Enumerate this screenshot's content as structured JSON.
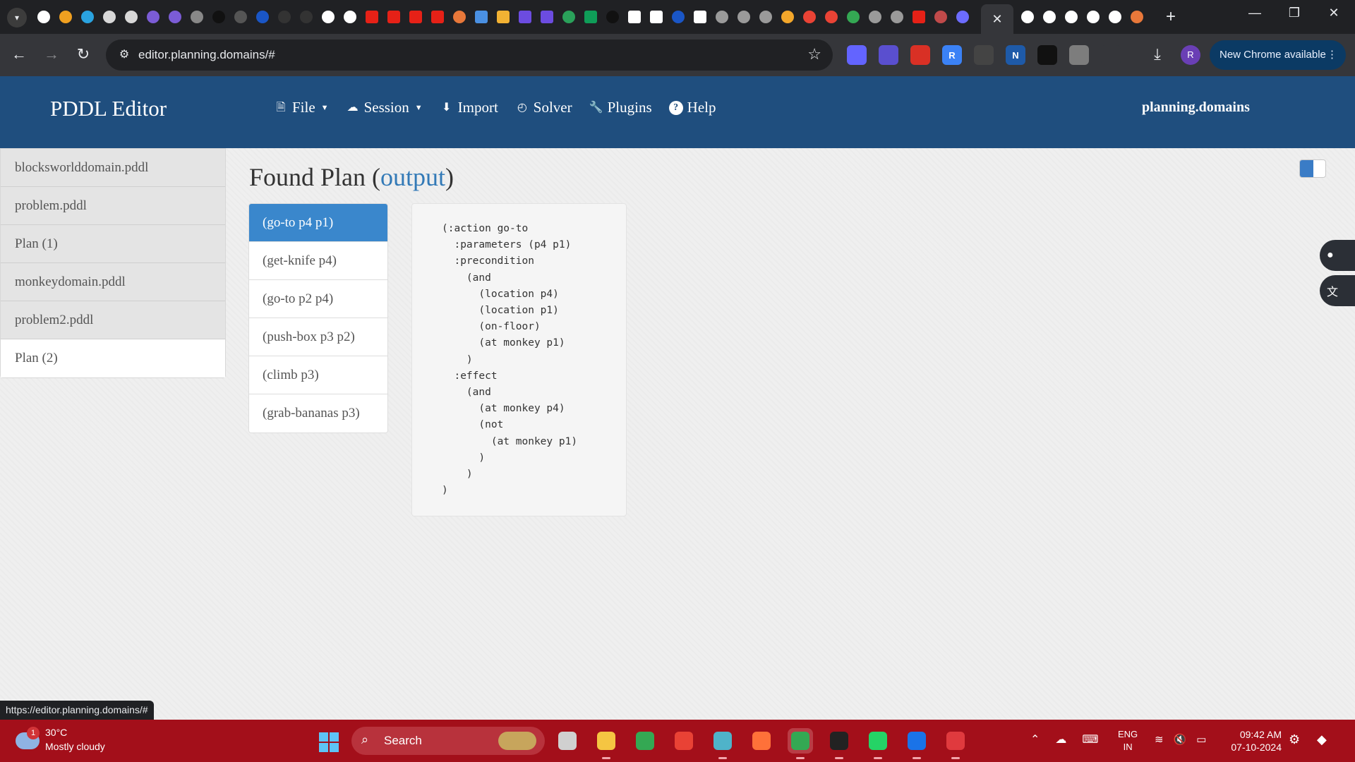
{
  "browser": {
    "close_tab_glyph": "✕",
    "new_tab_glyph": "+",
    "url": "editor.planning.domains/#",
    "update_button": "New Chrome available",
    "profile_initial": "R",
    "favicons": [
      {
        "icon": "google-icon",
        "color": "#ffffff"
      },
      {
        "icon": "runner-icon",
        "color": "#f0a020"
      },
      {
        "icon": "cube-icon",
        "color": "#2aa3e0"
      },
      {
        "icon": "openai-icon",
        "color": "#d8d8d8"
      },
      {
        "icon": "openai-icon",
        "color": "#d8d8d8"
      },
      {
        "icon": "figma-icon",
        "color": "#7b5cd6"
      },
      {
        "icon": "figma-icon",
        "color": "#7b5cd6"
      },
      {
        "icon": "play-icon",
        "color": "#888888"
      },
      {
        "icon": "dark-circle-icon",
        "color": "#111111"
      },
      {
        "icon": "moon-icon",
        "color": "#555555"
      },
      {
        "icon": "unstop-icon",
        "color": "#1a56c6"
      },
      {
        "icon": "n-icon",
        "color": "#333333"
      },
      {
        "icon": "n-icon",
        "color": "#333333"
      },
      {
        "icon": "google-icon",
        "color": "#ffffff"
      },
      {
        "icon": "google-icon",
        "color": "#ffffff"
      },
      {
        "icon": "youtube-icon",
        "color": "#e62117"
      },
      {
        "icon": "youtube-icon",
        "color": "#e62117"
      },
      {
        "icon": "youtube-icon",
        "color": "#e62117"
      },
      {
        "icon": "youtube-icon",
        "color": "#e62117"
      },
      {
        "icon": "in-icon",
        "color": "#e8783a"
      },
      {
        "icon": "chat-icon",
        "color": "#4a90e2"
      },
      {
        "icon": "box-icon",
        "color": "#f2b233"
      },
      {
        "icon": "list-icon",
        "color": "#6c4ce0"
      },
      {
        "icon": "list-icon",
        "color": "#6c4ce0"
      },
      {
        "icon": "plus-circle-icon",
        "color": "#2aa15a"
      },
      {
        "icon": "plus-square-icon",
        "color": "#0f9d58"
      },
      {
        "icon": "dark-circle-icon",
        "color": "#111111"
      },
      {
        "icon": "wix-icon",
        "color": "#ffffff"
      },
      {
        "icon": "wix-icon",
        "color": "#ffffff"
      },
      {
        "icon": "unstop-icon",
        "color": "#1a56c6"
      },
      {
        "icon": "wix-icon",
        "color": "#ffffff"
      },
      {
        "icon": "globe-icon",
        "color": "#9a9a9a"
      },
      {
        "icon": "globe-icon",
        "color": "#9a9a9a"
      },
      {
        "icon": "globe-icon",
        "color": "#9a9a9a"
      },
      {
        "icon": "infinity-icon",
        "color": "#f3a72b"
      },
      {
        "icon": "gmail-icon",
        "color": "#ea4335"
      },
      {
        "icon": "gmail-icon",
        "color": "#ea4335"
      },
      {
        "icon": "pin-icon",
        "color": "#34a853"
      },
      {
        "icon": "globe-icon",
        "color": "#9a9a9a"
      },
      {
        "icon": "globe-icon",
        "color": "#9a9a9a"
      },
      {
        "icon": "youtube-icon",
        "color": "#e62117"
      },
      {
        "icon": "bot-icon",
        "color": "#c04a4a"
      },
      {
        "icon": "stack-icon",
        "color": "#6c6cff"
      }
    ],
    "extra_tabs": [
      {
        "icon": "github-icon",
        "color": "#ffffff"
      },
      {
        "icon": "github-icon",
        "color": "#ffffff"
      },
      {
        "icon": "github-icon",
        "color": "#ffffff"
      },
      {
        "icon": "github-icon",
        "color": "#ffffff"
      },
      {
        "icon": "github-icon",
        "color": "#ffffff"
      },
      {
        "icon": "in-icon",
        "color": "#e8783a"
      }
    ],
    "extensions": [
      {
        "icon": "mastodon-icon",
        "color": "#6364ff"
      },
      {
        "icon": "copilot-face-icon",
        "color": "#5a4fcf"
      },
      {
        "icon": "infinity-icon",
        "color": "#d93025"
      },
      {
        "icon": "r-icon",
        "color": "#3b82f6",
        "text": "R"
      },
      {
        "icon": "magnifier-icon",
        "color": "#444444"
      },
      {
        "icon": "n-icon",
        "color": "#1e5aa8",
        "text": "N"
      },
      {
        "icon": "openai-icon",
        "color": "#111111"
      },
      {
        "icon": "gray-circle-icon",
        "color": "#7d7d7d"
      },
      {
        "icon": "puzzle-icon",
        "color": "#35363a"
      }
    ]
  },
  "app": {
    "brand": "PDDL Editor",
    "menu": [
      {
        "label": "File",
        "icon": "file-icon",
        "glyph": "🗎",
        "caret": true
      },
      {
        "label": "Session",
        "icon": "cloud-icon",
        "glyph": "☁",
        "caret": true
      },
      {
        "label": "Import",
        "icon": "download-circle-icon",
        "glyph": "⬇",
        "caret": false
      },
      {
        "label": "Solver",
        "icon": "dashboard-icon",
        "glyph": "◴",
        "caret": false
      },
      {
        "label": "Plugins",
        "icon": "wrench-icon",
        "glyph": "🔧",
        "caret": false
      },
      {
        "label": "Help",
        "icon": "question-circle-icon",
        "glyph": "?",
        "caret": false
      }
    ],
    "site_link": "planning.domains",
    "accent": "#1f4e7e"
  },
  "sidebar": {
    "items": [
      {
        "label": "blocksworlddomain.pddl",
        "active": false
      },
      {
        "label": "problem.pddl",
        "active": false
      },
      {
        "label": "Plan (1)",
        "active": false
      },
      {
        "label": "monkeydomain.pddl",
        "active": false
      },
      {
        "label": "problem2.pddl",
        "active": false
      },
      {
        "label": "Plan (2)",
        "active": true
      }
    ]
  },
  "main": {
    "title_prefix": "Found Plan (",
    "title_link": "output",
    "title_suffix": ")",
    "plan_steps": [
      {
        "label": "(go-to p4 p1)",
        "active": true
      },
      {
        "label": "(get-knife p4)",
        "active": false
      },
      {
        "label": "(go-to p2 p4)",
        "active": false
      },
      {
        "label": "(push-box p3 p2)",
        "active": false
      },
      {
        "label": "(climb p3)",
        "active": false
      },
      {
        "label": "(grab-bananas p3)",
        "active": false
      }
    ],
    "action_code": "(:action go-to\n  :parameters (p4 p1)\n  :precondition\n    (and\n      (location p4)\n      (location p1)\n      (on-floor)\n      (at monkey p1)\n    )\n  :effect\n    (and\n      (at monkey p4)\n      (not\n        (at monkey p1)\n      )\n    )\n)",
    "selection_color": "#3a87cc"
  },
  "status_bar_url": "https://editor.planning.domains/#",
  "taskbar": {
    "weather_badge": "1",
    "temperature": "30°C",
    "condition": "Mostly cloudy",
    "search_label": "Search",
    "apps": [
      {
        "icon": "task-view-icon",
        "color": "#d0d0d0",
        "active": false,
        "running": false
      },
      {
        "icon": "file-explorer-icon",
        "color": "#f5c542",
        "active": false,
        "running": true
      },
      {
        "icon": "chrome-icon",
        "color": "#34a853",
        "active": false,
        "running": false
      },
      {
        "icon": "color-wheel-icon",
        "color": "#e94235",
        "active": false,
        "running": false
      },
      {
        "icon": "keyboard-app-icon",
        "color": "#4fb3c9",
        "active": false,
        "running": true
      },
      {
        "icon": "firefox-icon",
        "color": "#ff7139",
        "active": false,
        "running": false
      },
      {
        "icon": "chrome-profile-icon",
        "color": "#34a853",
        "active": true,
        "running": true
      },
      {
        "icon": "bug-icon",
        "color": "#222222",
        "active": false,
        "running": true
      },
      {
        "icon": "whatsapp-icon",
        "color": "#25d366",
        "active": false,
        "running": true
      },
      {
        "icon": "app-a-icon",
        "color": "#1a73e8",
        "active": false,
        "running": true
      },
      {
        "icon": "wps-icon",
        "color": "#e03a3e",
        "active": false,
        "running": true
      }
    ],
    "lang_top": "ENG",
    "lang_bottom": "IN",
    "time": "09:42 AM",
    "date": "07-10-2024"
  }
}
